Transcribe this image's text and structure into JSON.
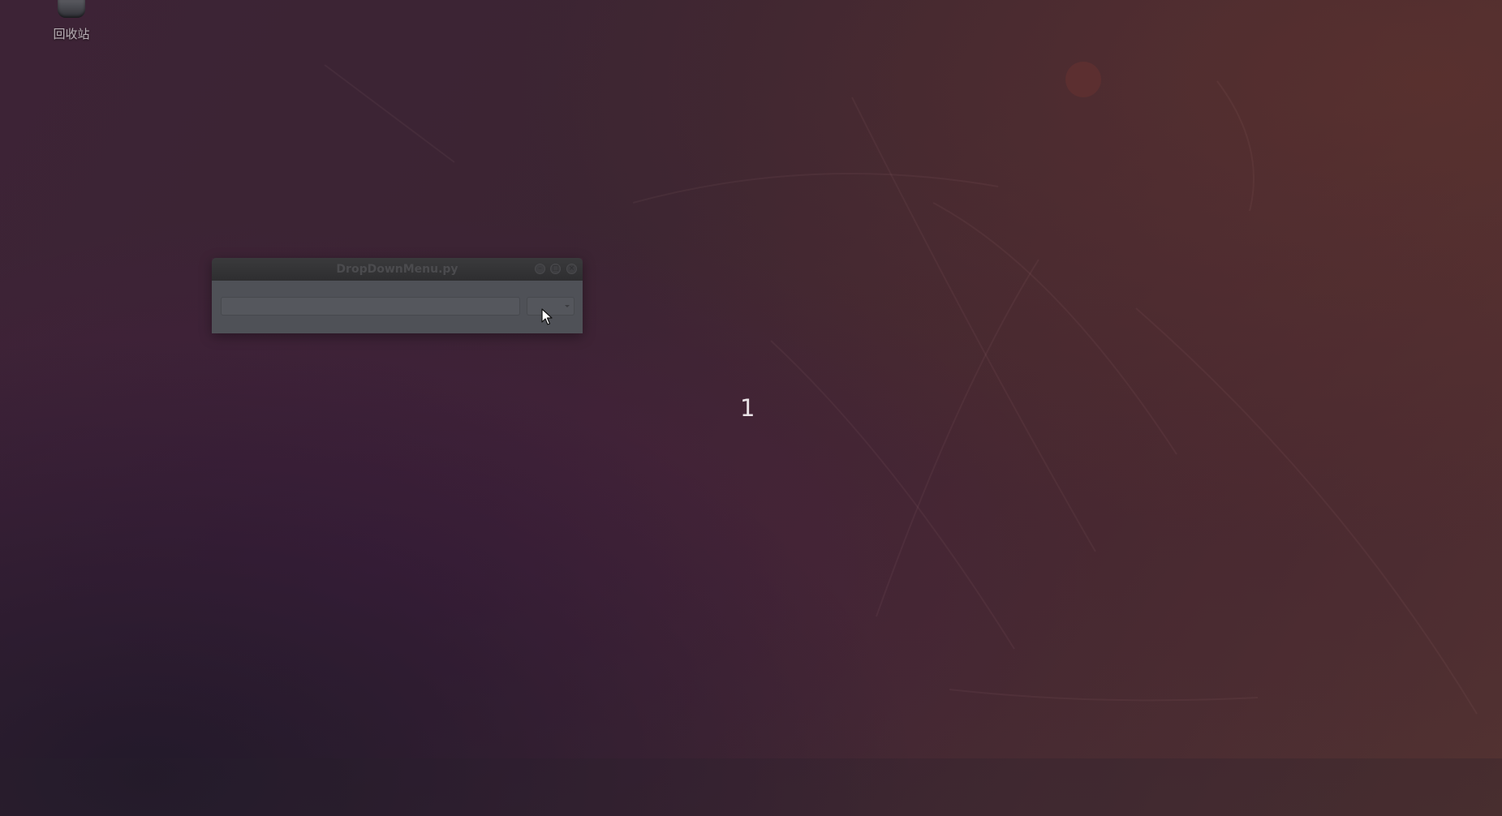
{
  "desktop": {
    "icons": [
      {
        "label": "回收站",
        "icon": "trash-icon"
      }
    ],
    "overlay_text": "1"
  },
  "window": {
    "title": "DropDownMenu.py",
    "buttons": {
      "minimize_icon": "minimize-icon",
      "maximize_icon": "maximize-icon",
      "close_icon": "close-icon"
    },
    "entry": {
      "value": "",
      "placeholder": ""
    },
    "dropdown": {
      "selected": "",
      "icon": "chevron-down-icon"
    }
  },
  "colors": {
    "wallpaper_dark": "#3d2336",
    "wallpaper_warm": "#533331",
    "titlebar": "#2e2e30",
    "client_background": "#4f5157"
  }
}
